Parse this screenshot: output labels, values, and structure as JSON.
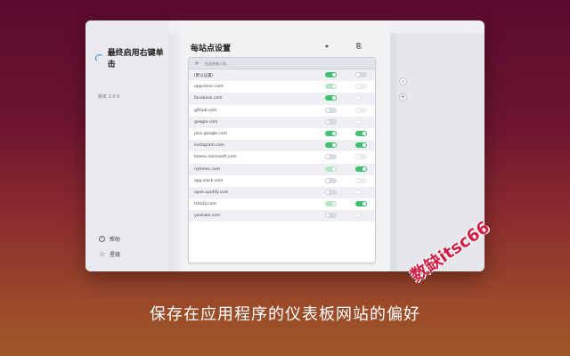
{
  "app": {
    "title": "最终启用右键单击",
    "version": "版本 2.0.0",
    "sidebar_links": [
      {
        "label": "帮助",
        "icon": "help-icon"
      },
      {
        "label": "星级",
        "icon": "star-icon"
      }
    ]
  },
  "main": {
    "title": "每站点设置",
    "column_icons": [
      "click-icon",
      "copy-icon"
    ],
    "column_icon_glyphs": [
      "⌖",
      "⎘"
    ],
    "add_placeholder": "在此处输入网..."
  },
  "sites": [
    {
      "name": "(默认设置)",
      "t1": "on",
      "t2": "off"
    },
    {
      "name": "appcanvs.com",
      "t1": "soft-on",
      "t2": "off-faint"
    },
    {
      "name": "facebook.com",
      "t1": "on",
      "t2": "off-faint"
    },
    {
      "name": "github.com",
      "t1": "off",
      "t2": "off-faint"
    },
    {
      "name": "google.com",
      "t1": "off",
      "t2": "off-faint"
    },
    {
      "name": "plus.google.com",
      "t1": "on",
      "t2": "on"
    },
    {
      "name": "instagram.com",
      "t1": "on",
      "t2": "on"
    },
    {
      "name": "teams.microsoft.com",
      "t1": "off",
      "t2": "off-faint"
    },
    {
      "name": "nytimes.com",
      "t1": "soft-on",
      "t2": "on"
    },
    {
      "name": "app.slack.com",
      "t1": "off",
      "t2": "off-faint"
    },
    {
      "name": "open.spotify.com",
      "t1": "off",
      "t2": "off-faint"
    },
    {
      "name": "tistory.com",
      "t1": "soft-on",
      "t2": "on"
    },
    {
      "name": "youtube.com",
      "t1": "off",
      "t2": "off-faint"
    }
  ],
  "caption": "保存在应用程序的仪表板网站的偏好",
  "watermark": "数缺itsc66",
  "colors": {
    "accent_green": "#3ec170",
    "logo_blue": "#2f8ae8"
  }
}
